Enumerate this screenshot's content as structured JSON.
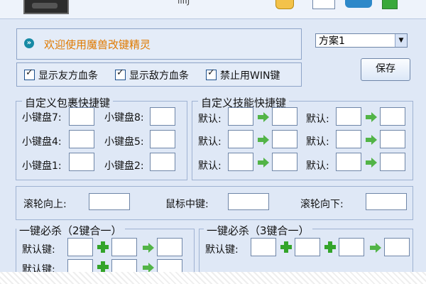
{
  "top": {
    "fragment": "ilIIJ"
  },
  "welcome": {
    "text": "欢迎使用魔兽改键精灵"
  },
  "options": {
    "show_ally_hp": "显示友方血条",
    "show_enemy_hp": "显示敌方血条",
    "disable_win": "禁止用WIN键"
  },
  "scheme": {
    "selected": "方案1"
  },
  "save_label": "保存",
  "pack_group": {
    "title": "自定义包裹快捷键",
    "keys": [
      "小键盘7:",
      "小键盘8:",
      "小键盘4:",
      "小键盘5:",
      "小键盘1:",
      "小键盘2:"
    ]
  },
  "skill_group": {
    "title": "自定义技能快捷键",
    "default_label": "默认:"
  },
  "scroll": {
    "up": "滚轮向上:",
    "middle": "鼠标中键:",
    "down": "滚轮向下:"
  },
  "combo2": {
    "title": "一键必杀（2键合一）",
    "default_key": "默认键:"
  },
  "combo3": {
    "title": "一键必杀（3键合一）",
    "default_key": "默认键:"
  },
  "colors": {
    "panel_bg": "#e4ecf8",
    "border": "#8ea4c7",
    "welcome_text": "#e07a00",
    "arrow_green": "#52b447",
    "plus_green": "#33a42a"
  }
}
